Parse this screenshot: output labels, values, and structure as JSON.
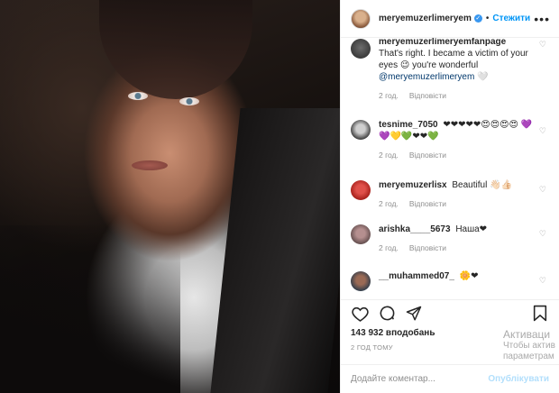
{
  "header": {
    "username": "meryemuzerlimeryem",
    "verified_mark": "✓",
    "separator": "•",
    "follow_label": "Стежити",
    "more_label": "•••"
  },
  "comments": [
    {
      "username": "meryemuzerlimeryemfanpage",
      "text": "That's right. I became a victim of your eyes 😉 you're wonderful",
      "mention": "@meryemuzerlimeryem",
      "emoji": "🤍",
      "time": "2 год.",
      "reply": "Відповісти"
    },
    {
      "username": "tesnime_7050",
      "text": "❤❤❤❤❤😍😍😍😍 💜💜💛💚❤❤💚",
      "time": "2 год.",
      "reply": "Відповісти"
    },
    {
      "username": "meryemuzerlisx",
      "text": "Beautiful 👋🏻👍🏻",
      "time": "2 год.",
      "reply": "Відповісти"
    },
    {
      "username": "arishka____5673",
      "text": "Наша❤",
      "time": "2 год.",
      "reply": "Відповісти"
    },
    {
      "username": "__muhammed07_",
      "text": "🌼❤",
      "time": "",
      "reply": ""
    }
  ],
  "likes": "143 932 вподобань",
  "time_ago": "2 ГОД ТОМУ",
  "watermark": {
    "line1": "Активаци",
    "line2": "Чтобы актив",
    "line3": "параметрам"
  },
  "add_comment": {
    "placeholder": "Додайте коментар...",
    "publish_label": "Опублікувати"
  },
  "icons": [
    "heart-icon",
    "comment-icon",
    "share-icon",
    "bookmark-icon"
  ],
  "colors": {
    "accent": "#0095f6",
    "muted": "#8e8e8e",
    "publish_disabled": "#b2dffc"
  }
}
